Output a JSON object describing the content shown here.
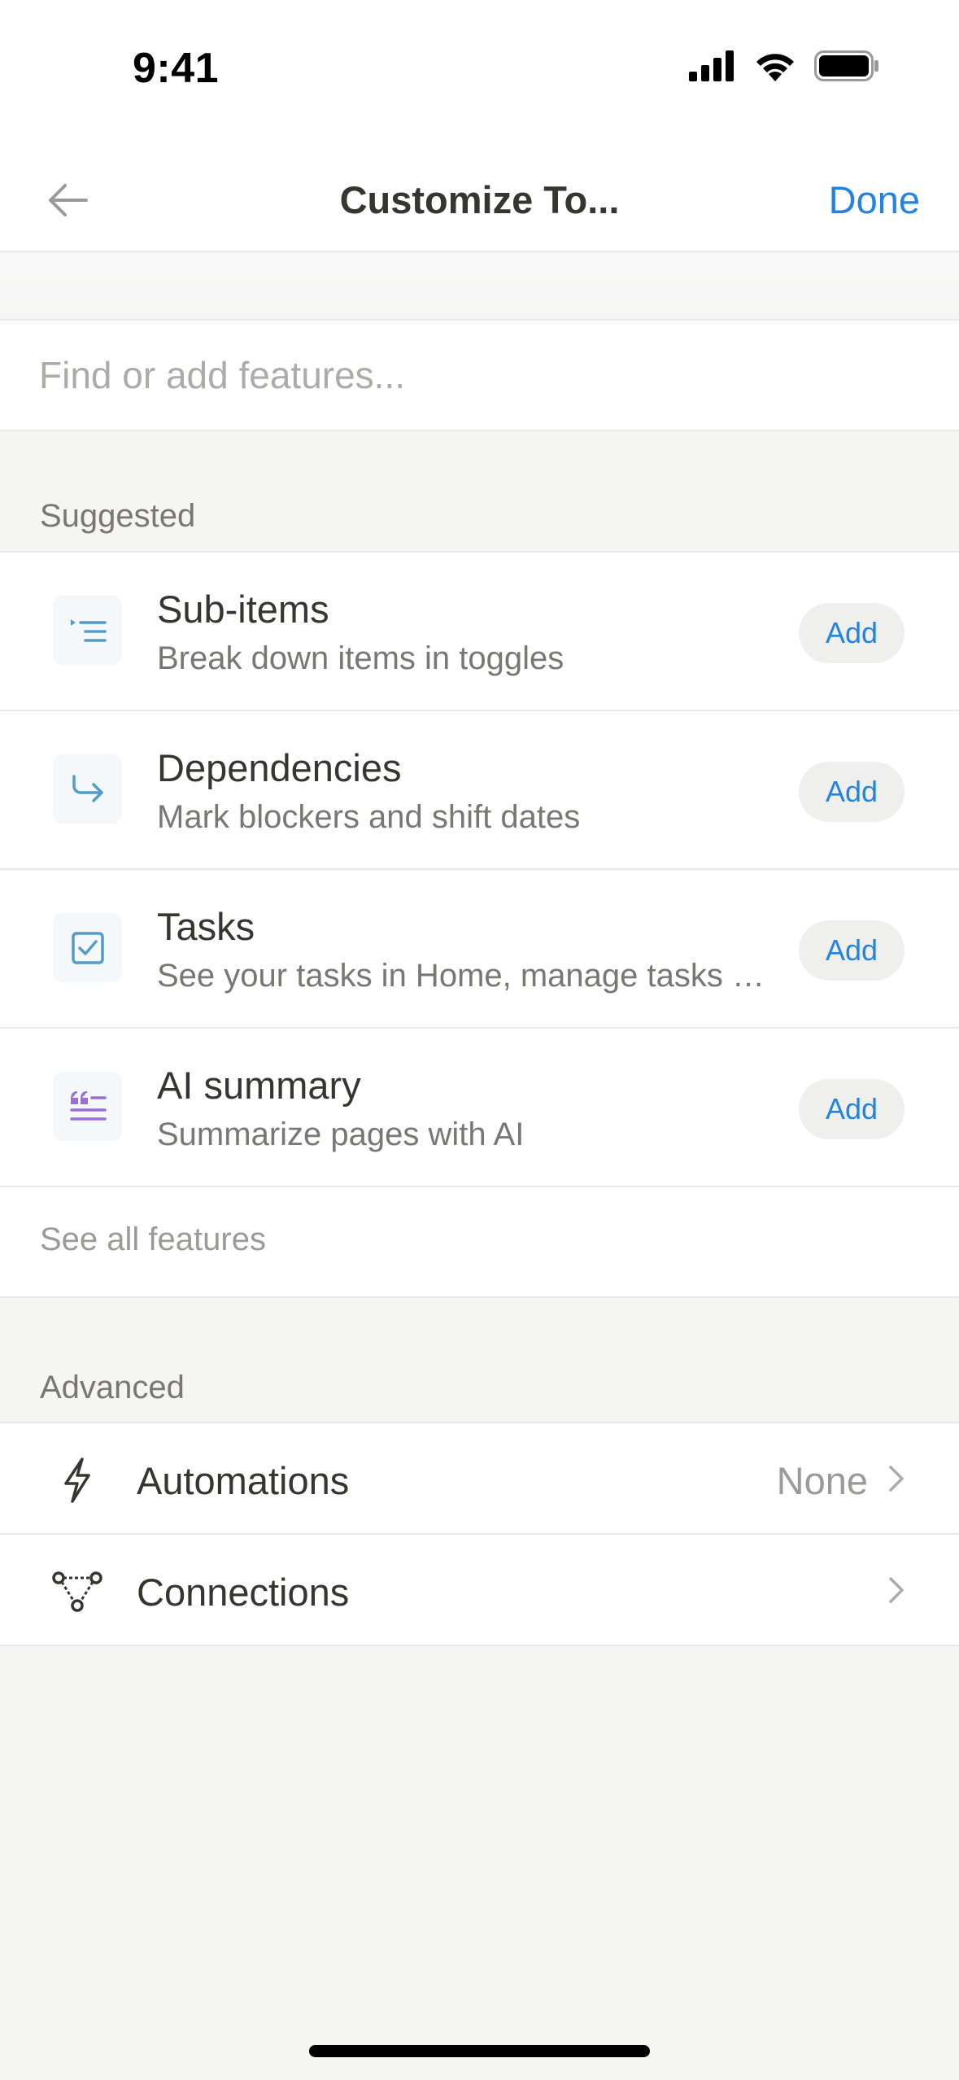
{
  "status_bar": {
    "time": "9:41"
  },
  "nav": {
    "title": "Customize To...",
    "done_label": "Done"
  },
  "search": {
    "placeholder": "Find or add features..."
  },
  "suggested": {
    "label": "Suggested",
    "items": [
      {
        "title": "Sub-items",
        "description": "Break down items in toggles",
        "action": "Add",
        "icon": "sub-items-icon"
      },
      {
        "title": "Dependencies",
        "description": "Mark blockers and shift dates",
        "action": "Add",
        "icon": "dependencies-icon"
      },
      {
        "title": "Tasks",
        "description": "See your tasks in Home, manage tasks with AI and more",
        "action": "Add",
        "icon": "checkbox-icon"
      },
      {
        "title": "AI summary",
        "description": "Summarize pages with AI",
        "action": "Add",
        "icon": "ai-summary-icon"
      }
    ],
    "see_all": "See all features"
  },
  "advanced": {
    "label": "Advanced",
    "items": [
      {
        "label": "Automations",
        "value": "None",
        "icon": "lightning-icon"
      },
      {
        "label": "Connections",
        "value": "",
        "icon": "connections-icon"
      }
    ]
  },
  "colors": {
    "accent": "#2383e2",
    "ai_purple": "#9a6dd7",
    "icon_blue": "#529cca"
  }
}
